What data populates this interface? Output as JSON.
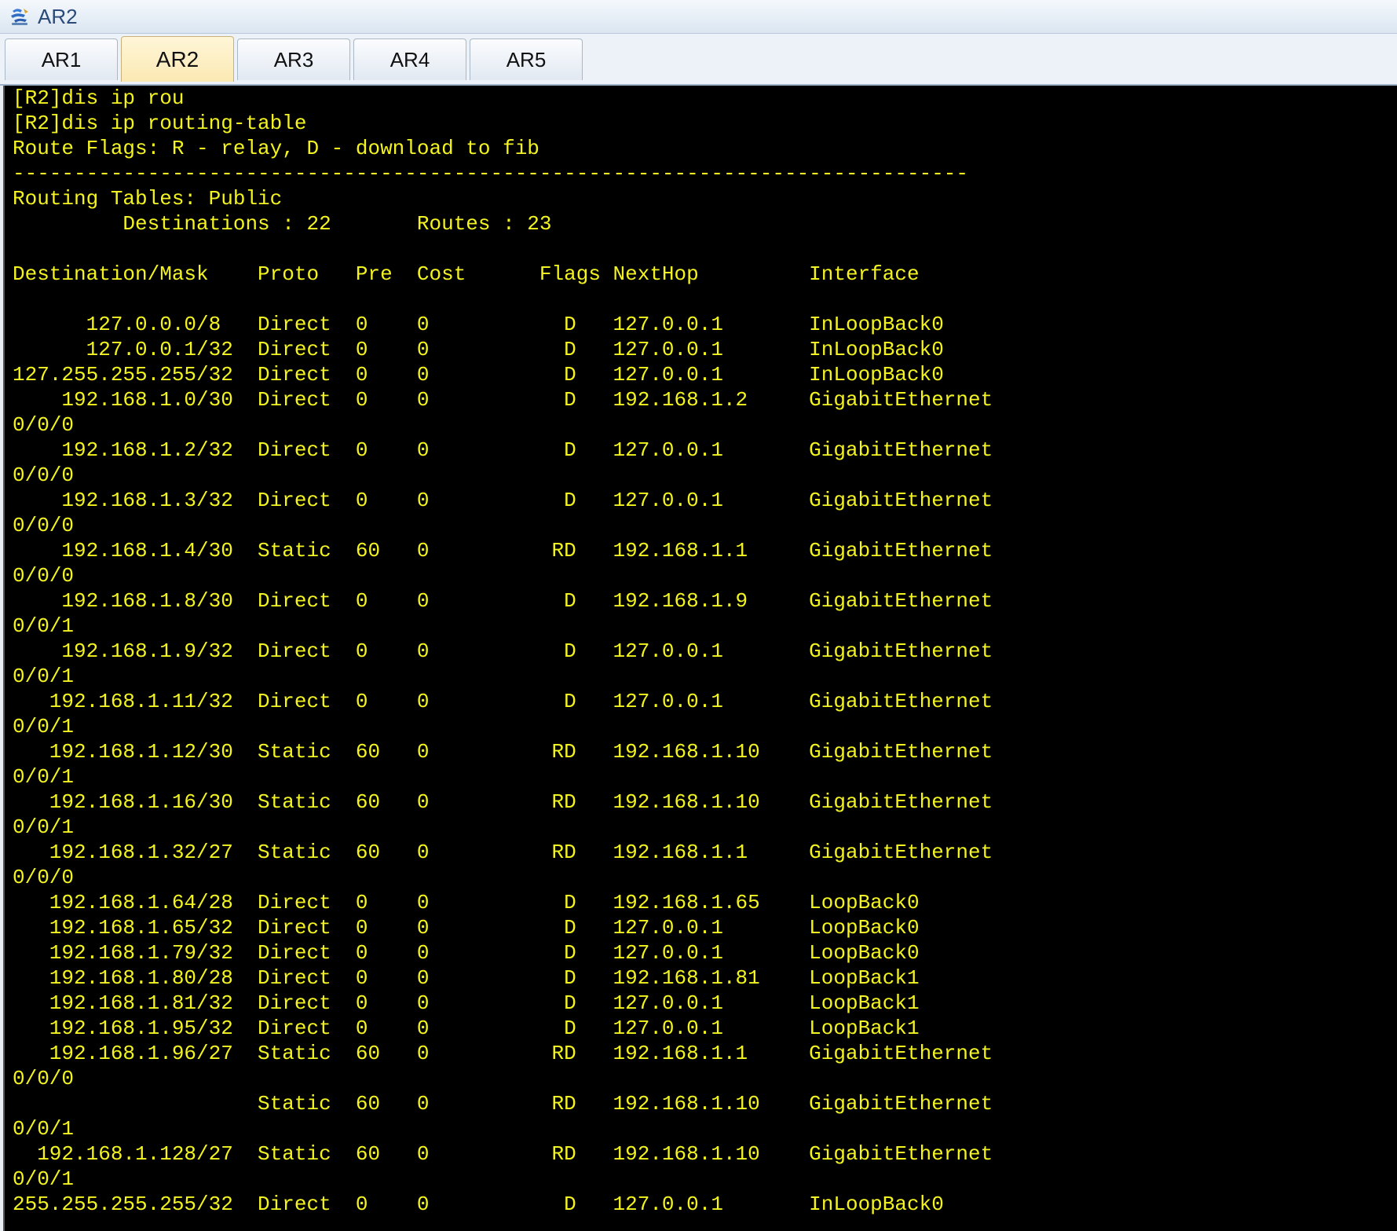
{
  "window": {
    "title": "AR2",
    "icon": "router-app-icon"
  },
  "tabs": [
    {
      "label": "AR1",
      "active": false
    },
    {
      "label": "AR2",
      "active": true
    },
    {
      "label": "AR3",
      "active": false
    },
    {
      "label": "AR4",
      "active": false
    },
    {
      "label": "AR5",
      "active": false
    }
  ],
  "colors": {
    "terminal_background": "#000000",
    "terminal_text": "#f3f321",
    "active_tab": "#fbe9b3"
  },
  "terminal": {
    "lines": [
      "[R2]dis ip rou",
      "[R2]dis ip routing-table",
      "Route Flags: R - relay, D - download to fib",
      "------------------------------------------------------------------------------",
      "Routing Tables: Public",
      "         Destinations : 22       Routes : 23",
      "",
      "Destination/Mask    Proto   Pre  Cost      Flags NextHop         Interface",
      "",
      "      127.0.0.0/8   Direct  0    0           D   127.0.0.1       InLoopBack0",
      "      127.0.0.1/32  Direct  0    0           D   127.0.0.1       InLoopBack0",
      "127.255.255.255/32  Direct  0    0           D   127.0.0.1       InLoopBack0",
      "    192.168.1.0/30  Direct  0    0           D   192.168.1.2     GigabitEthernet",
      "0/0/0",
      "    192.168.1.2/32  Direct  0    0           D   127.0.0.1       GigabitEthernet",
      "0/0/0",
      "    192.168.1.3/32  Direct  0    0           D   127.0.0.1       GigabitEthernet",
      "0/0/0",
      "    192.168.1.4/30  Static  60   0          RD   192.168.1.1     GigabitEthernet",
      "0/0/0",
      "    192.168.1.8/30  Direct  0    0           D   192.168.1.9     GigabitEthernet",
      "0/0/1",
      "    192.168.1.9/32  Direct  0    0           D   127.0.0.1       GigabitEthernet",
      "0/0/1",
      "   192.168.1.11/32  Direct  0    0           D   127.0.0.1       GigabitEthernet",
      "0/0/1",
      "   192.168.1.12/30  Static  60   0          RD   192.168.1.10    GigabitEthernet",
      "0/0/1",
      "   192.168.1.16/30  Static  60   0          RD   192.168.1.10    GigabitEthernet",
      "0/0/1",
      "   192.168.1.32/27  Static  60   0          RD   192.168.1.1     GigabitEthernet",
      "0/0/0",
      "   192.168.1.64/28  Direct  0    0           D   192.168.1.65    LoopBack0",
      "   192.168.1.65/32  Direct  0    0           D   127.0.0.1       LoopBack0",
      "   192.168.1.79/32  Direct  0    0           D   127.0.0.1       LoopBack0",
      "   192.168.1.80/28  Direct  0    0           D   192.168.1.81    LoopBack1",
      "   192.168.1.81/32  Direct  0    0           D   127.0.0.1       LoopBack1",
      "   192.168.1.95/32  Direct  0    0           D   127.0.0.1       LoopBack1",
      "   192.168.1.96/27  Static  60   0          RD   192.168.1.1     GigabitEthernet",
      "0/0/0",
      "                    Static  60   0          RD   192.168.1.10    GigabitEthernet",
      "0/0/1",
      "  192.168.1.128/27  Static  60   0          RD   192.168.1.10    GigabitEthernet",
      "0/0/1",
      "255.255.255.255/32  Direct  0    0           D   127.0.0.1       InLoopBack0"
    ]
  }
}
